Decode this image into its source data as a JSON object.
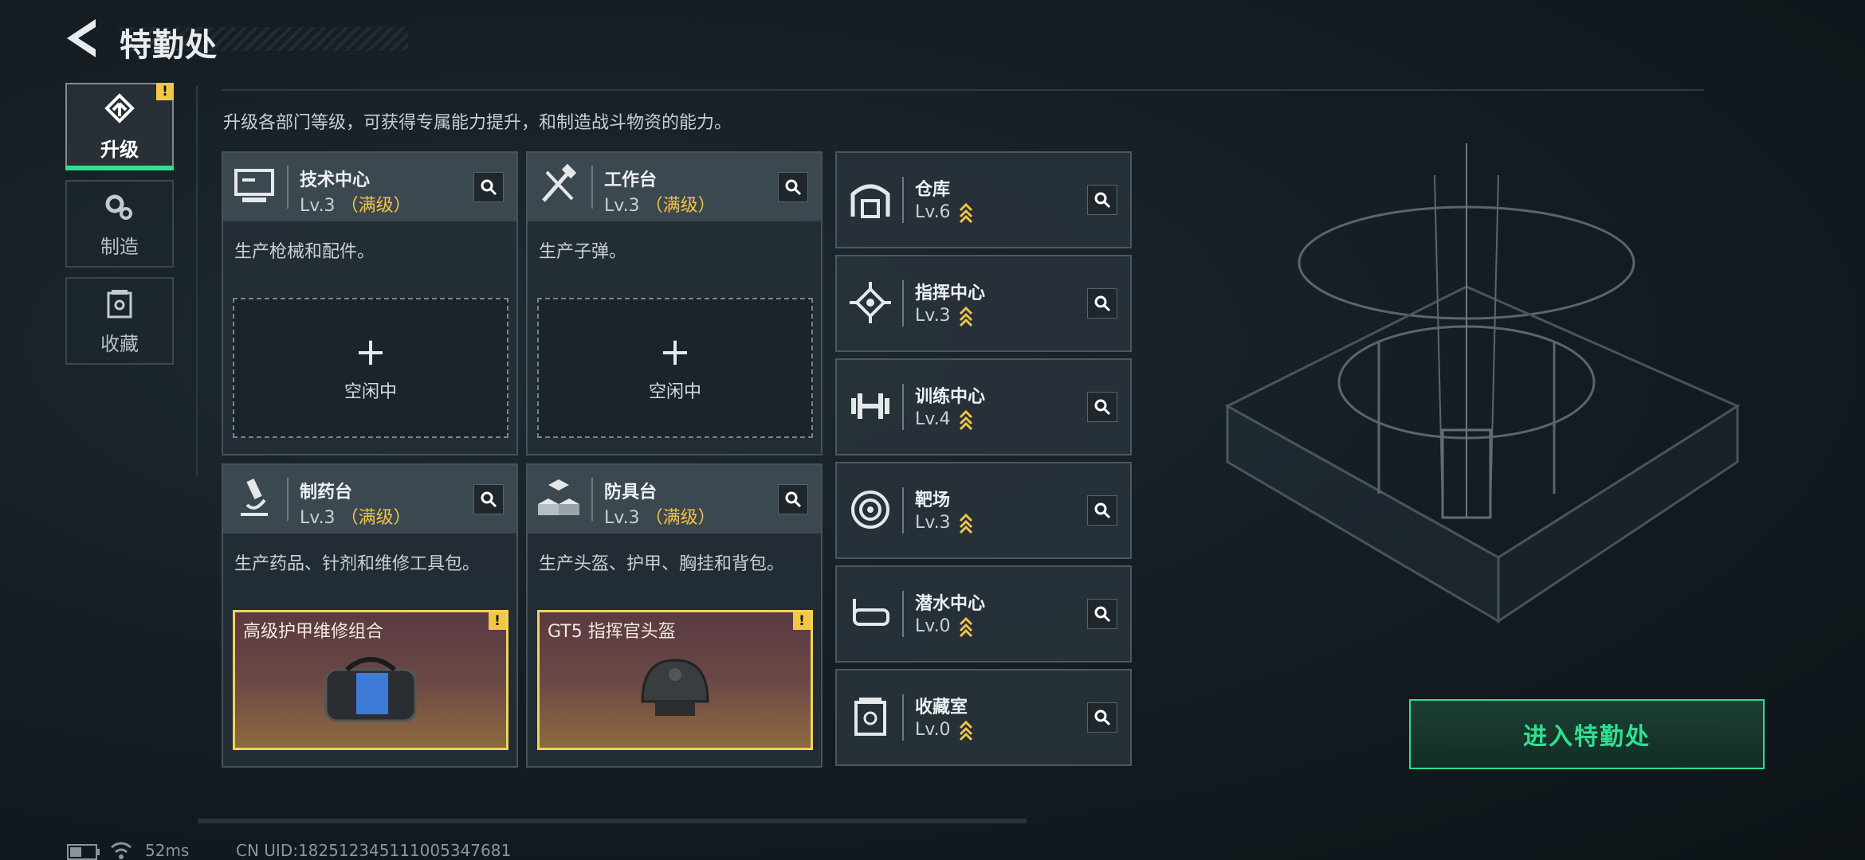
{
  "header": {
    "title": "特勤处"
  },
  "tabs": [
    {
      "label": "升级",
      "icon": "upgrade-icon",
      "active": true,
      "warning": "!"
    },
    {
      "label": "制造",
      "icon": "gears-icon",
      "active": false
    },
    {
      "label": "收藏",
      "icon": "collection-icon",
      "active": false
    }
  ],
  "description": "升级各部门等级，可获得专属能力提升，和制造战斗物资的能力。",
  "production_cards": [
    {
      "name": "技术中心",
      "level": "Lv.3",
      "max": "（满级）",
      "desc": "生产枪械和配件。",
      "slot": {
        "state": "idle",
        "text": "空闲中",
        "plus": "+"
      }
    },
    {
      "name": "工作台",
      "level": "Lv.3",
      "max": "（满级）",
      "desc": "生产子弹。",
      "slot": {
        "state": "idle",
        "text": "空闲中",
        "plus": "+"
      }
    },
    {
      "name": "制药台",
      "level": "Lv.3",
      "max": "（满级）",
      "desc": "生产药品、针剂和维修工具包。",
      "slot": {
        "state": "item",
        "text": "高级护甲维修组合",
        "warning": "!"
      }
    },
    {
      "name": "防具台",
      "level": "Lv.3",
      "max": "（满级）",
      "desc": "生产头盔、护甲、胸挂和背包。",
      "slot": {
        "state": "item",
        "text": "GT5 指挥官头盔",
        "warning": "!"
      }
    }
  ],
  "facilities": [
    {
      "name": "仓库",
      "level": "Lv.6"
    },
    {
      "name": "指挥中心",
      "level": "Lv.3"
    },
    {
      "name": "训练中心",
      "level": "Lv.4"
    },
    {
      "name": "靶场",
      "level": "Lv.3"
    },
    {
      "name": "潜水中心",
      "level": "Lv.0"
    },
    {
      "name": "收藏室",
      "level": "Lv.0"
    }
  ],
  "enter_button": "进入特勤处",
  "footer": {
    "latency": "52ms",
    "uid": "CN UID:18251234511100534768​1"
  },
  "colors": {
    "accent": "#2fe08f",
    "max_level": "#f0c24b",
    "warning": "#f2c744"
  }
}
